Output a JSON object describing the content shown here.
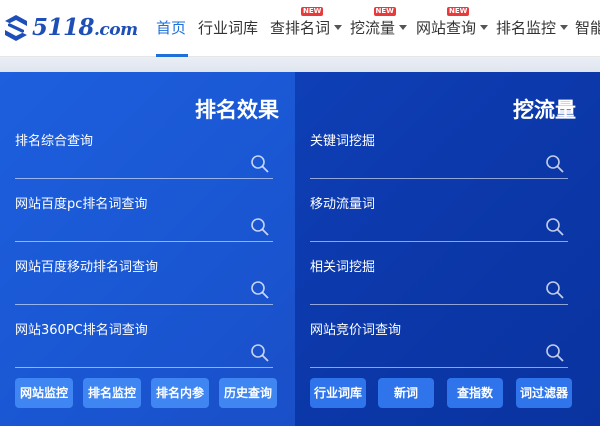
{
  "brand": {
    "logo_text": "5118",
    "logo_suffix": ".com",
    "color": "#1e4fb8"
  },
  "nav": {
    "items": [
      {
        "label": "首页",
        "active": true,
        "dropdown": false
      },
      {
        "label": "行业词库",
        "active": false,
        "dropdown": false
      },
      {
        "label": "查排名词",
        "active": false,
        "dropdown": true,
        "badge": "NEW"
      },
      {
        "label": "挖流量",
        "active": false,
        "dropdown": true,
        "badge": "NEW"
      },
      {
        "label": "网站查询",
        "active": false,
        "dropdown": true,
        "badge": "NEW"
      },
      {
        "label": "排名监控",
        "active": false,
        "dropdown": true
      },
      {
        "label": "智能",
        "active": false,
        "dropdown": false
      }
    ]
  },
  "panels": [
    {
      "title": "排名效果",
      "fields": [
        {
          "label": "排名综合查询",
          "icon": "search-icon"
        },
        {
          "label": "网站百度pc排名词查询",
          "icon": "search-icon"
        },
        {
          "label": "网站百度移动排名词查询",
          "icon": "search-icon"
        },
        {
          "label": "网站360PC排名词查询",
          "icon": "search-icon"
        }
      ],
      "buttons": [
        "网站监控",
        "排名监控",
        "排名内参",
        "历史查询"
      ]
    },
    {
      "title": "挖流量",
      "fields": [
        {
          "label": "关键词挖掘",
          "icon": "search-icon"
        },
        {
          "label": "移动流量词",
          "icon": "search-icon"
        },
        {
          "label": "相关词挖掘",
          "icon": "search-icon"
        },
        {
          "label": "网站竞价词查询",
          "icon": "search-icon"
        }
      ],
      "buttons": [
        "行业词库",
        "新词",
        "查指数",
        "词过滤器"
      ]
    }
  ],
  "colors": {
    "accent": "#1e6fd9",
    "badge": "#e83a3a",
    "panel_left": "#1a56d2",
    "panel_right": "#0b37a8"
  }
}
